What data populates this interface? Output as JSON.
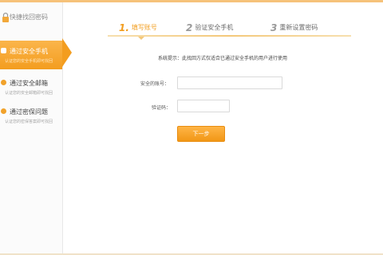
{
  "brand": {
    "text": "快捷找回密码",
    "icon": "lock-icon"
  },
  "sidebar": {
    "items": [
      {
        "title": "通过安全手机",
        "subtitle": "认证您的安全手机即可找回",
        "active": true
      },
      {
        "title": "通过安全邮箱",
        "subtitle": "认证您的安全邮箱即可找回",
        "active": false
      },
      {
        "title": "通过密保问题",
        "subtitle": "认证您的密保答案即可找回",
        "active": false
      }
    ]
  },
  "steps": [
    {
      "num": "1.",
      "label": "填写账号",
      "active": true
    },
    {
      "num": "2",
      "label": "验证安全手机",
      "active": false
    },
    {
      "num": "3",
      "label": "重新设置密码",
      "active": false
    }
  ],
  "notice": "系统提示：此找回方式仅适合已通过安全手机的用户进行使用",
  "form": {
    "phone_label": "安全的账号：",
    "phone_value": "",
    "code_label": "验证码：",
    "code_value": "",
    "submit_label": "下一步"
  },
  "colors": {
    "accent": "#f39d1f",
    "accent_light": "#fbb54b",
    "border": "#e7e7e7"
  }
}
